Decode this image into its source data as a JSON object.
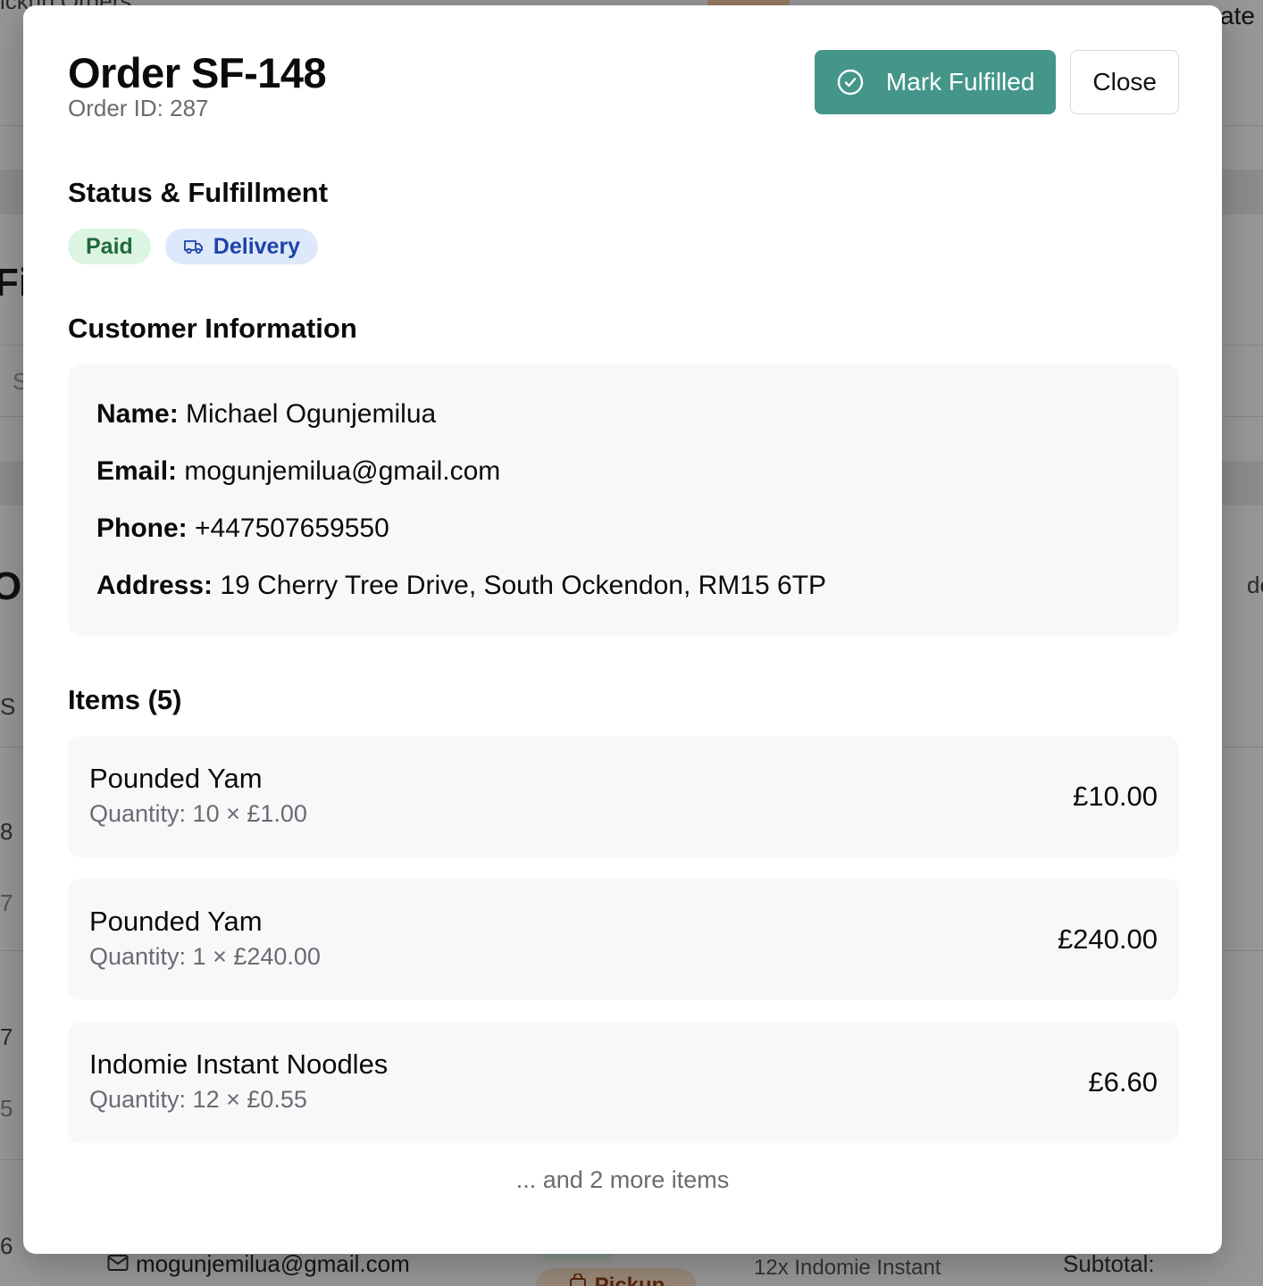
{
  "background": {
    "fragments": [
      {
        "text": "ickup Orders"
      },
      {
        "text": "ate"
      },
      {
        "text": "Fi"
      },
      {
        "text": "S"
      },
      {
        "text": "O"
      },
      {
        "text": "de"
      },
      {
        "text": "S"
      },
      {
        "text": "8"
      },
      {
        "text": "7"
      },
      {
        "text": "7"
      },
      {
        "text": "5"
      },
      {
        "text": "6"
      },
      {
        "text": "12x Indomie Instant"
      },
      {
        "text": "Subtotal:"
      }
    ],
    "email": "mogunjemilua@gmail.com",
    "pickup_badge": "Pickup"
  },
  "modal": {
    "title": "Order SF-148",
    "order_id": "Order ID: 287",
    "actions": {
      "fulfill_label": "Mark Fulfilled",
      "close_label": "Close"
    },
    "status_section": {
      "title": "Status & Fulfillment",
      "payment_badge": "Paid",
      "fulfillment_badge": "Delivery"
    },
    "customer_section": {
      "title": "Customer Information",
      "name_label": "Name:",
      "name": "Michael Ogunjemilua",
      "email_label": "Email:",
      "email": "mogunjemilua@gmail.com",
      "phone_label": "Phone:",
      "phone": "+447507659550",
      "address_label": "Address:",
      "address": "19 Cherry Tree Drive, South Ockendon, RM15 6TP"
    },
    "items_section": {
      "title": "Items (5)",
      "items": [
        {
          "name": "Pounded Yam",
          "quantity": "Quantity: 10 × £1.00",
          "total": "£10.00"
        },
        {
          "name": "Pounded Yam",
          "quantity": "Quantity: 1 × £240.00",
          "total": "£240.00"
        },
        {
          "name": "Indomie Instant Noodles",
          "quantity": "Quantity: 12 × £0.55",
          "total": "£6.60"
        }
      ],
      "more_items": "... and 2 more items"
    }
  },
  "colors": {
    "primary": "#44968a",
    "paid_bg": "#dcf5e3",
    "paid_text": "#1f6a38",
    "delivery_bg": "#dde8fb",
    "delivery_text": "#1d43a8"
  },
  "icons": {
    "fulfill": "check-circle-icon",
    "delivery": "truck-icon",
    "background_email": "mail-icon",
    "background_pickup": "bag-icon"
  }
}
